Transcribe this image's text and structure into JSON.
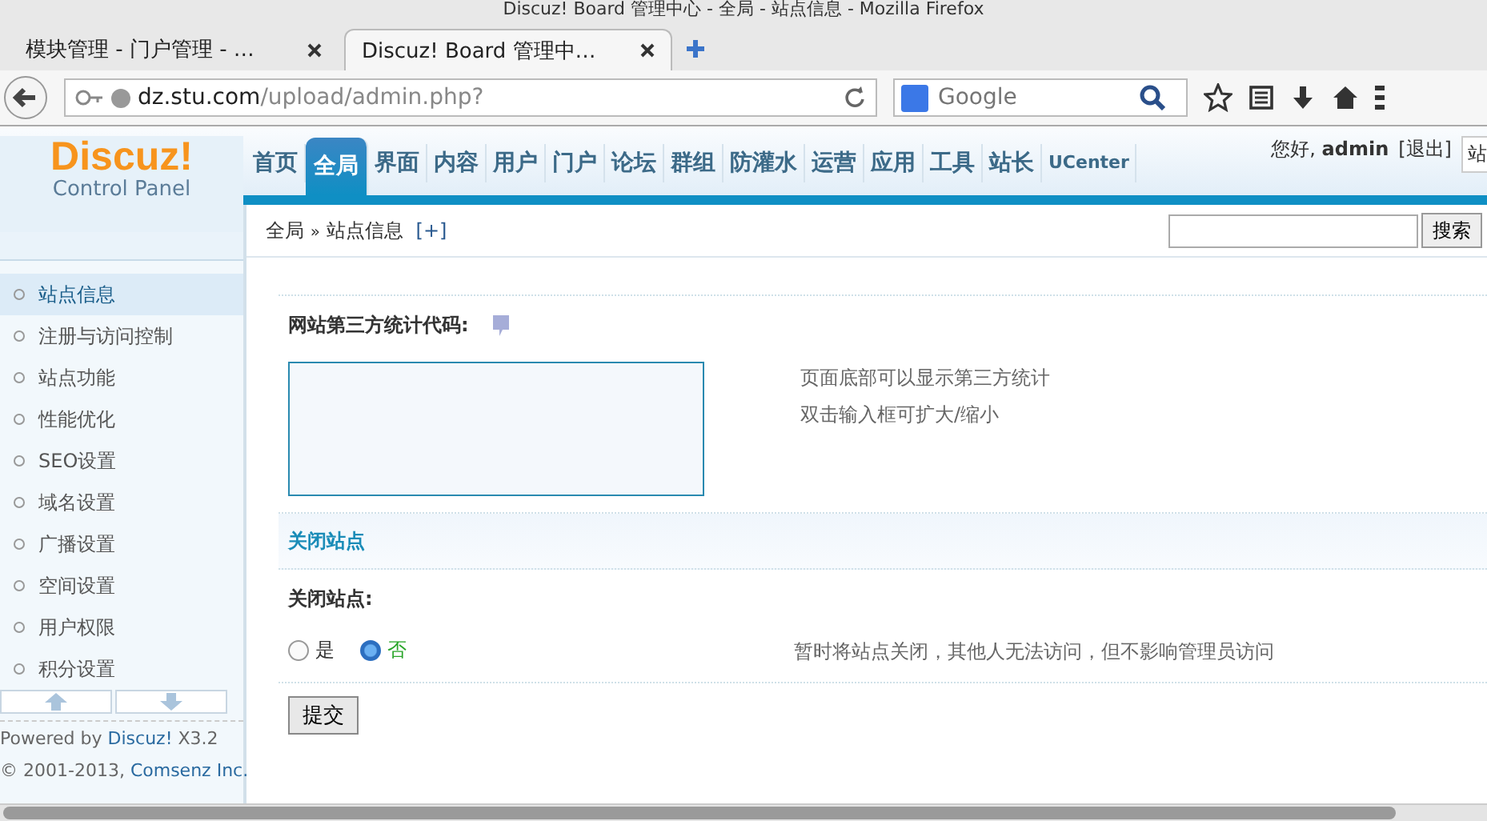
{
  "browser": {
    "title": "Discuz! Board 管理中心 - 全局 - 站点信息 - Mozilla Firefox",
    "tabs": [
      {
        "label": "模块管理 - 门户管理 - …",
        "selected": false
      },
      {
        "label": "Discuz! Board 管理中…",
        "selected": true
      }
    ],
    "url": {
      "host": "dz.stu.com",
      "path": "/upload/admin.php?"
    },
    "search_placeholder": "Google"
  },
  "header": {
    "logo": "Discuz!",
    "logo_subtitle": "Control Panel",
    "nav": [
      {
        "label": "首页",
        "selected": false
      },
      {
        "label": "全局",
        "selected": true
      },
      {
        "label": "界面",
        "selected": false
      },
      {
        "label": "内容",
        "selected": false
      },
      {
        "label": "用户",
        "selected": false
      },
      {
        "label": "门户",
        "selected": false
      },
      {
        "label": "论坛",
        "selected": false
      },
      {
        "label": "群组",
        "selected": false
      },
      {
        "label": "防灌水",
        "selected": false
      },
      {
        "label": "运营",
        "selected": false
      },
      {
        "label": "应用",
        "selected": false
      },
      {
        "label": "工具",
        "selected": false
      },
      {
        "label": "站长",
        "selected": false
      },
      {
        "label": "UCenter",
        "selected": false
      }
    ],
    "greeting": "您好,",
    "user": "admin",
    "logout": "[退出]",
    "site_button": "站"
  },
  "breadcrumb": {
    "items": [
      "全局",
      "站点信息"
    ],
    "separator": "»",
    "toggle": "[+]",
    "search_button": "搜索"
  },
  "sidebar": {
    "items": [
      {
        "label": "站点信息",
        "selected": true
      },
      {
        "label": "注册与访问控制",
        "selected": false
      },
      {
        "label": "站点功能",
        "selected": false
      },
      {
        "label": "性能优化",
        "selected": false
      },
      {
        "label": "SEO设置",
        "selected": false
      },
      {
        "label": "域名设置",
        "selected": false
      },
      {
        "label": "广播设置",
        "selected": false
      },
      {
        "label": "空间设置",
        "selected": false
      },
      {
        "label": "用户权限",
        "selected": false
      },
      {
        "label": "积分设置",
        "selected": false
      }
    ],
    "powered": "Powered by",
    "product": "Discuz!",
    "version": "X3.2",
    "copyright": "© 2001-2013,",
    "company": "Comsenz Inc."
  },
  "settings": [
    {
      "kind": "textarea",
      "label": "网站第三方统计代码:",
      "help": true,
      "hints": [
        "页面底部可以显示第三方统计",
        "双击输入框可扩大/缩小"
      ]
    },
    {
      "kind": "section",
      "title": "关闭站点"
    },
    {
      "kind": "radio",
      "label": "关闭站点:",
      "options": [
        {
          "label": "是",
          "selected": false
        },
        {
          "label": "否",
          "selected": true
        }
      ],
      "hints": [
        "暂时将站点关闭，其他人无法访问，但不影响管理员访问"
      ]
    }
  ],
  "submit": "提交"
}
